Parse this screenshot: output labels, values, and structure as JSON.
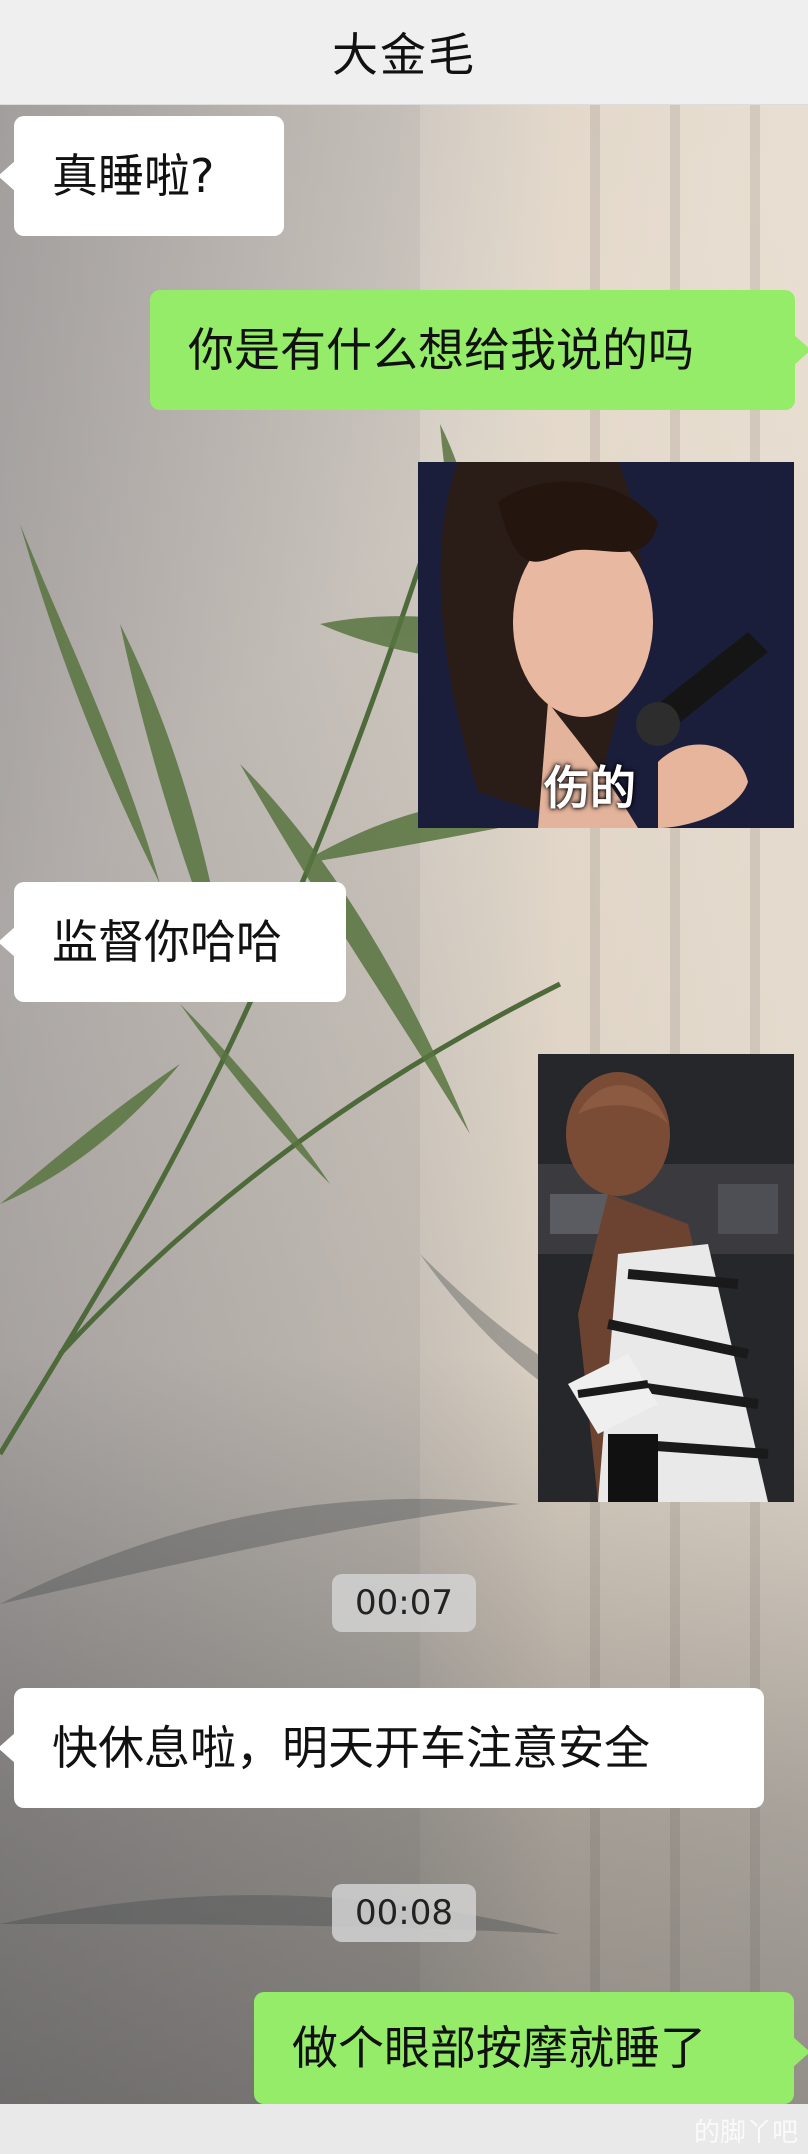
{
  "header": {
    "contact_name": "大金毛"
  },
  "messages": [
    {
      "side": "left",
      "type": "text",
      "text": "真睡啦?"
    },
    {
      "side": "right",
      "type": "text",
      "text": "你是有什么想给我说的吗"
    },
    {
      "side": "right",
      "type": "sticker",
      "caption": "伤的",
      "icon": "singer-girl-sticker"
    },
    {
      "side": "left",
      "type": "text",
      "text": "监督你哈哈"
    },
    {
      "side": "right",
      "type": "sticker",
      "caption": "",
      "icon": "bald-woman-sticker"
    },
    {
      "type": "time",
      "text": "00:07"
    },
    {
      "side": "left",
      "type": "text",
      "text": "快休息啦，明天开车注意安全"
    },
    {
      "type": "time",
      "text": "00:08"
    },
    {
      "side": "right",
      "type": "text",
      "text": "做个眼部按摩就睡了"
    }
  ],
  "watermark": "的脚丫吧",
  "colors": {
    "self_bubble": "#95ec69",
    "other_bubble": "#ffffff",
    "title_bar": "#efefef"
  }
}
